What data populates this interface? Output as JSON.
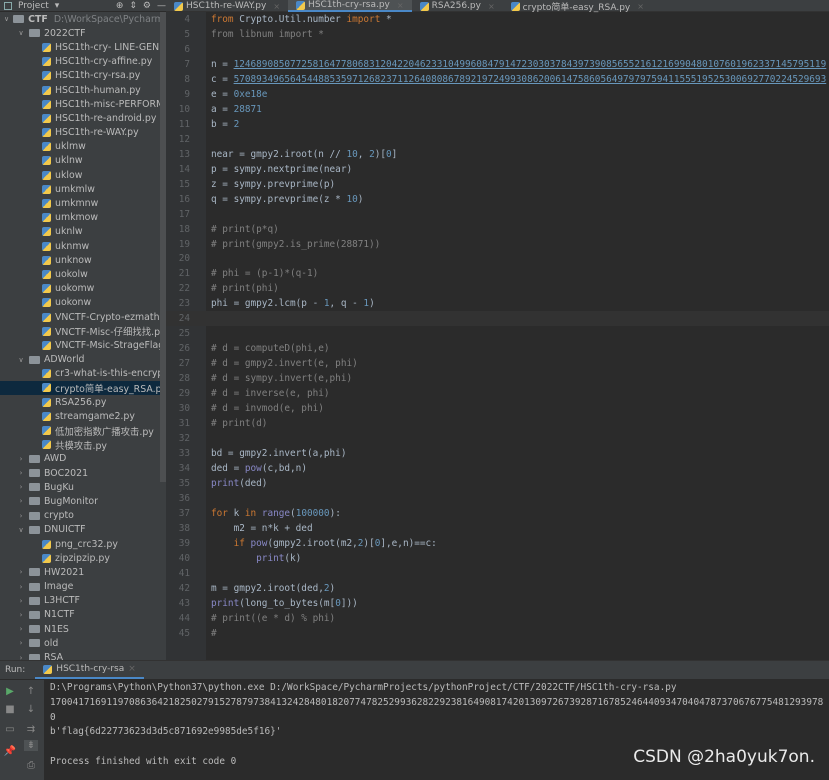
{
  "topbar": {
    "project_label": "Project"
  },
  "tabs": [
    {
      "label": "HSC1th-re-WAY.py",
      "active": false
    },
    {
      "label": "HSC1th-cry-rsa.py",
      "active": true
    },
    {
      "label": "RSA256.py",
      "active": false
    },
    {
      "label": "crypto简单-easy_RSA.py",
      "active": false
    }
  ],
  "tree": [
    {
      "label": "CTF",
      "path": "D:\\WorkSpace\\PycharmPro",
      "type": "folder",
      "open": true,
      "depth": 0
    },
    {
      "label": "2022CTF",
      "type": "folder",
      "open": true,
      "depth": 1
    },
    {
      "label": "HSC1th-cry- LINE-GENERA",
      "type": "file",
      "depth": 2
    },
    {
      "label": "HSC1th-cry-affine.py",
      "type": "file",
      "depth": 2
    },
    {
      "label": "HSC1th-cry-rsa.py",
      "type": "file",
      "depth": 2
    },
    {
      "label": "HSC1th-human.py",
      "type": "file",
      "depth": 2
    },
    {
      "label": "HSC1th-misc-PERFORMAN",
      "type": "file",
      "depth": 2
    },
    {
      "label": "HSC1th-re-android.py",
      "type": "file",
      "depth": 2
    },
    {
      "label": "HSC1th-re-WAY.py",
      "type": "file",
      "depth": 2
    },
    {
      "label": "uklmw",
      "type": "file",
      "depth": 2
    },
    {
      "label": "uklnw",
      "type": "file",
      "depth": 2
    },
    {
      "label": "uklow",
      "type": "file",
      "depth": 2
    },
    {
      "label": "umkmlw",
      "type": "file",
      "depth": 2
    },
    {
      "label": "umkmnw",
      "type": "file",
      "depth": 2
    },
    {
      "label": "umkmow",
      "type": "file",
      "depth": 2
    },
    {
      "label": "uknlw",
      "type": "file",
      "depth": 2
    },
    {
      "label": "uknmw",
      "type": "file",
      "depth": 2
    },
    {
      "label": "unknow",
      "type": "file",
      "depth": 2
    },
    {
      "label": "uokolw",
      "type": "file",
      "depth": 2
    },
    {
      "label": "uokomw",
      "type": "file",
      "depth": 2
    },
    {
      "label": "uokonw",
      "type": "file",
      "depth": 2
    },
    {
      "label": "VNCTF-Crypto-ezmath.py",
      "type": "file",
      "depth": 2
    },
    {
      "label": "VNCTF-Misc-仔细找找.py",
      "type": "file",
      "depth": 2
    },
    {
      "label": "VNCTF-Msic-StrageFlag.py",
      "type": "file",
      "depth": 2
    },
    {
      "label": "ADWorld",
      "type": "folder",
      "open": true,
      "depth": 1
    },
    {
      "label": "cr3-what-is-this-encryption",
      "type": "file",
      "depth": 2
    },
    {
      "label": "crypto简单-easy_RSA.py",
      "type": "file",
      "depth": 2,
      "selected": true
    },
    {
      "label": "RSA256.py",
      "type": "file",
      "depth": 2
    },
    {
      "label": "streamgame2.py",
      "type": "file",
      "depth": 2
    },
    {
      "label": "低加密指数广播攻击.py",
      "type": "file",
      "depth": 2
    },
    {
      "label": "共模攻击.py",
      "type": "file",
      "depth": 2
    },
    {
      "label": "AWD",
      "type": "folder",
      "open": false,
      "depth": 1
    },
    {
      "label": "BOC2021",
      "type": "folder",
      "open": false,
      "depth": 1
    },
    {
      "label": "BugKu",
      "type": "folder",
      "open": false,
      "depth": 1
    },
    {
      "label": "BugMonitor",
      "type": "folder",
      "open": false,
      "depth": 1
    },
    {
      "label": "crypto",
      "type": "folder",
      "open": false,
      "depth": 1
    },
    {
      "label": "DNUICTF",
      "type": "folder",
      "open": true,
      "depth": 1
    },
    {
      "label": "png_crc32.py",
      "type": "file",
      "depth": 2
    },
    {
      "label": "zipzipzip.py",
      "type": "file",
      "depth": 2
    },
    {
      "label": "HW2021",
      "type": "folder",
      "open": false,
      "depth": 1
    },
    {
      "label": "Image",
      "type": "folder",
      "open": false,
      "depth": 1
    },
    {
      "label": "L3HCTF",
      "type": "folder",
      "open": false,
      "depth": 1
    },
    {
      "label": "N1CTF",
      "type": "folder",
      "open": false,
      "depth": 1
    },
    {
      "label": "N1ES",
      "type": "folder",
      "open": false,
      "depth": 1
    },
    {
      "label": "old",
      "type": "folder",
      "open": false,
      "depth": 1
    },
    {
      "label": "RSA",
      "type": "folder",
      "open": false,
      "depth": 1
    }
  ],
  "editor": {
    "current_line": 24,
    "lines": [
      {
        "n": 4,
        "s": [
          [
            "k",
            "from "
          ],
          [
            "t",
            "Crypto.Util.number "
          ],
          [
            "k",
            "import "
          ],
          [
            "t",
            "*"
          ]
        ]
      },
      {
        "n": 5,
        "s": [
          [
            "c",
            "from libnum import *"
          ]
        ]
      },
      {
        "n": 6,
        "s": []
      },
      {
        "n": 7,
        "s": [
          [
            "t",
            "n = "
          ],
          [
            "u",
            "124689085077258164778068312042204623310499608479147230303784397390856552161216990480107601962337145795119"
          ]
        ]
      },
      {
        "n": 8,
        "s": [
          [
            "t",
            "c = "
          ],
          [
            "u",
            "570893496564544885359712682371126408086789219724993086200614758605649797975941155519525300692770224529693"
          ]
        ]
      },
      {
        "n": 9,
        "s": [
          [
            "t",
            "e = "
          ],
          [
            "n",
            "0xe18e"
          ]
        ]
      },
      {
        "n": 10,
        "s": [
          [
            "t",
            "a = "
          ],
          [
            "n",
            "28871"
          ]
        ]
      },
      {
        "n": 11,
        "s": [
          [
            "t",
            "b = "
          ],
          [
            "n",
            "2"
          ]
        ]
      },
      {
        "n": 12,
        "s": []
      },
      {
        "n": 13,
        "s": [
          [
            "t",
            "near = gmpy2.iroot(n // "
          ],
          [
            "n",
            "10"
          ],
          [
            "t",
            ", "
          ],
          [
            "n",
            "2"
          ],
          [
            "t",
            ")["
          ],
          [
            "n",
            "0"
          ],
          [
            "t",
            "]"
          ]
        ]
      },
      {
        "n": 14,
        "s": [
          [
            "t",
            "p = sympy.nextprime(near)"
          ]
        ]
      },
      {
        "n": 15,
        "s": [
          [
            "t",
            "z = sympy.prevprime(p)"
          ]
        ]
      },
      {
        "n": 16,
        "s": [
          [
            "t",
            "q = sympy.prevprime(z * "
          ],
          [
            "n",
            "10"
          ],
          [
            "t",
            ")"
          ]
        ]
      },
      {
        "n": 17,
        "s": []
      },
      {
        "n": 18,
        "s": [
          [
            "c",
            "# print(p*q)"
          ]
        ]
      },
      {
        "n": 19,
        "s": [
          [
            "c",
            "# print(gmpy2.is_prime(28871))"
          ]
        ]
      },
      {
        "n": 20,
        "s": []
      },
      {
        "n": 21,
        "s": [
          [
            "c",
            "# phi = (p-1)*(q-1)"
          ]
        ]
      },
      {
        "n": 22,
        "s": [
          [
            "c",
            "# print(phi)"
          ]
        ]
      },
      {
        "n": 23,
        "s": [
          [
            "t",
            "phi = gmpy2.lcm(p - "
          ],
          [
            "n",
            "1"
          ],
          [
            "t",
            ", q - "
          ],
          [
            "n",
            "1"
          ],
          [
            "t",
            ")"
          ]
        ]
      },
      {
        "n": 24,
        "s": []
      },
      {
        "n": 25,
        "s": []
      },
      {
        "n": 26,
        "s": [
          [
            "c",
            "# d = computeD(phi,e)"
          ]
        ]
      },
      {
        "n": 27,
        "s": [
          [
            "c",
            "# d = gmpy2.invert(e, phi)"
          ]
        ]
      },
      {
        "n": 28,
        "s": [
          [
            "c",
            "# d = sympy.invert(e,phi)"
          ]
        ]
      },
      {
        "n": 29,
        "s": [
          [
            "c",
            "# d = inverse(e, phi)"
          ]
        ]
      },
      {
        "n": 30,
        "s": [
          [
            "c",
            "# d = invmod(e, phi)"
          ]
        ]
      },
      {
        "n": 31,
        "s": [
          [
            "c",
            "# print(d)"
          ]
        ]
      },
      {
        "n": 32,
        "s": []
      },
      {
        "n": 33,
        "s": [
          [
            "t",
            "bd = gmpy2.invert(a,phi)"
          ]
        ]
      },
      {
        "n": 34,
        "s": [
          [
            "t",
            "ded = "
          ],
          [
            "b",
            "pow"
          ],
          [
            "t",
            "(c,bd,n)"
          ]
        ]
      },
      {
        "n": 35,
        "s": [
          [
            "b",
            "print"
          ],
          [
            "t",
            "(ded)"
          ]
        ]
      },
      {
        "n": 36,
        "s": []
      },
      {
        "n": 37,
        "s": [
          [
            "k",
            "for "
          ],
          [
            "t",
            "k "
          ],
          [
            "k",
            "in "
          ],
          [
            "b",
            "range"
          ],
          [
            "t",
            "("
          ],
          [
            "n",
            "100000"
          ],
          [
            "t",
            "):"
          ]
        ]
      },
      {
        "n": 38,
        "s": [
          [
            "t",
            "    m2 = n*k + ded"
          ]
        ]
      },
      {
        "n": 39,
        "s": [
          [
            "t",
            "    "
          ],
          [
            "k",
            "if "
          ],
          [
            "b",
            "pow"
          ],
          [
            "t",
            "(gmpy2.iroot(m2,"
          ],
          [
            "n",
            "2"
          ],
          [
            "t",
            ")["
          ],
          [
            "n",
            "0"
          ],
          [
            "t",
            "],e,n)==c:"
          ]
        ]
      },
      {
        "n": 40,
        "s": [
          [
            "t",
            "        "
          ],
          [
            "b",
            "print"
          ],
          [
            "t",
            "(k)"
          ]
        ]
      },
      {
        "n": 41,
        "s": []
      },
      {
        "n": 42,
        "s": [
          [
            "t",
            "m = gmpy2.iroot(ded,"
          ],
          [
            "n",
            "2"
          ],
          [
            "t",
            ")"
          ]
        ]
      },
      {
        "n": 43,
        "s": [
          [
            "b",
            "print"
          ],
          [
            "t",
            "(long_to_bytes(m["
          ],
          [
            "n",
            "0"
          ],
          [
            "t",
            "]))"
          ]
        ]
      },
      {
        "n": 44,
        "s": [
          [
            "c",
            "# print((e * d) % phi)"
          ]
        ]
      },
      {
        "n": 45,
        "s": [
          [
            "c",
            "#"
          ]
        ]
      }
    ]
  },
  "run": {
    "label": "Run:",
    "tab": "HSC1th-cry-rsa",
    "output": [
      "D:\\Programs\\Python\\Python37\\python.exe D:/WorkSpace/PycharmProjects/pythonProject/CTF/2022CTF/HSC1th-cry-rsa.py",
      "17004171691197086364218250279152787973841324284801820774782529936282292381649081742013097267392871678524644093470404787370676775481293978",
      "0",
      "b'flag{6d22773623d3d5c871692e9985de5f16}'",
      "",
      "Process finished with exit code 0"
    ]
  },
  "watermark": "CSDN @2ha0yuk7on."
}
